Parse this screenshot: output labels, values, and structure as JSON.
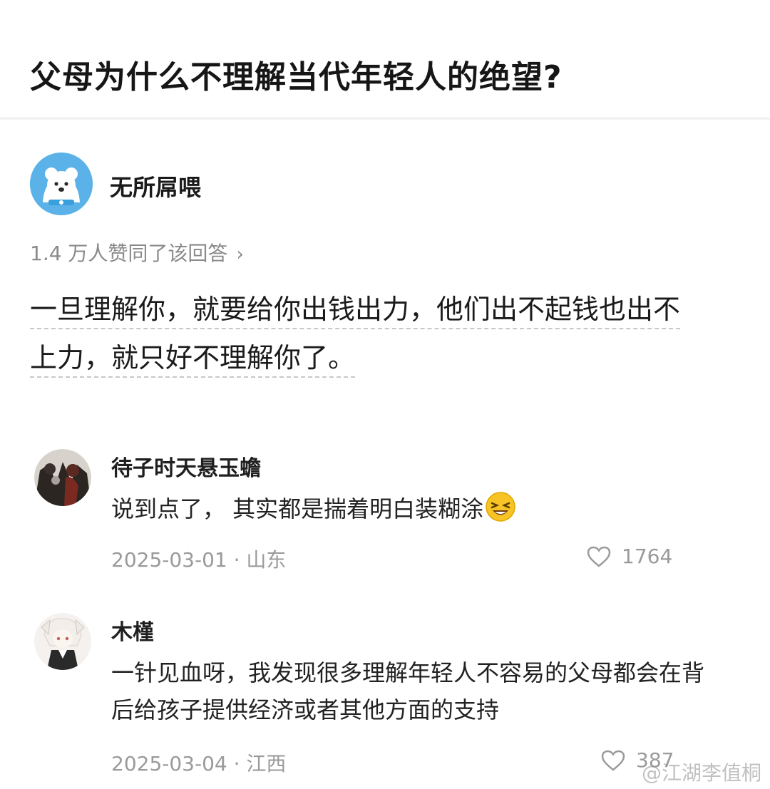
{
  "question": {
    "title": "父母为什么不理解当代年轻人的绝望?"
  },
  "answer": {
    "author": "无所屌喂",
    "votes_text": "1.4 万人赞同了该回答",
    "body_line1": "一旦理解你，就要给你出钱出力，他们出不起钱也出不",
    "body_line2": "上力，就只好不理解你了。"
  },
  "comments": [
    {
      "name": "待子时天悬玉蟾",
      "text": "说到点了， 其实都是揣着明白装糊涂",
      "date_location": "2025-03-01 · 山东",
      "likes": "1764",
      "avatar_icon": "dark-illustration-avatar",
      "emoji_icon": "laughing-emoji-icon"
    },
    {
      "name": "木槿",
      "text": "一针见血呀，我发现很多理解年轻人不容易的父母都会在背后给孩子提供经济或者其他方面的支持",
      "date_location": "2025-03-04 · 江西",
      "likes": "387",
      "avatar_icon": "anime-girl-avatar"
    }
  ],
  "watermark": "@江湖李值桐",
  "colors": {
    "avatar_main": "#5ab2e8",
    "meta_gray": "#9a9a9a"
  }
}
